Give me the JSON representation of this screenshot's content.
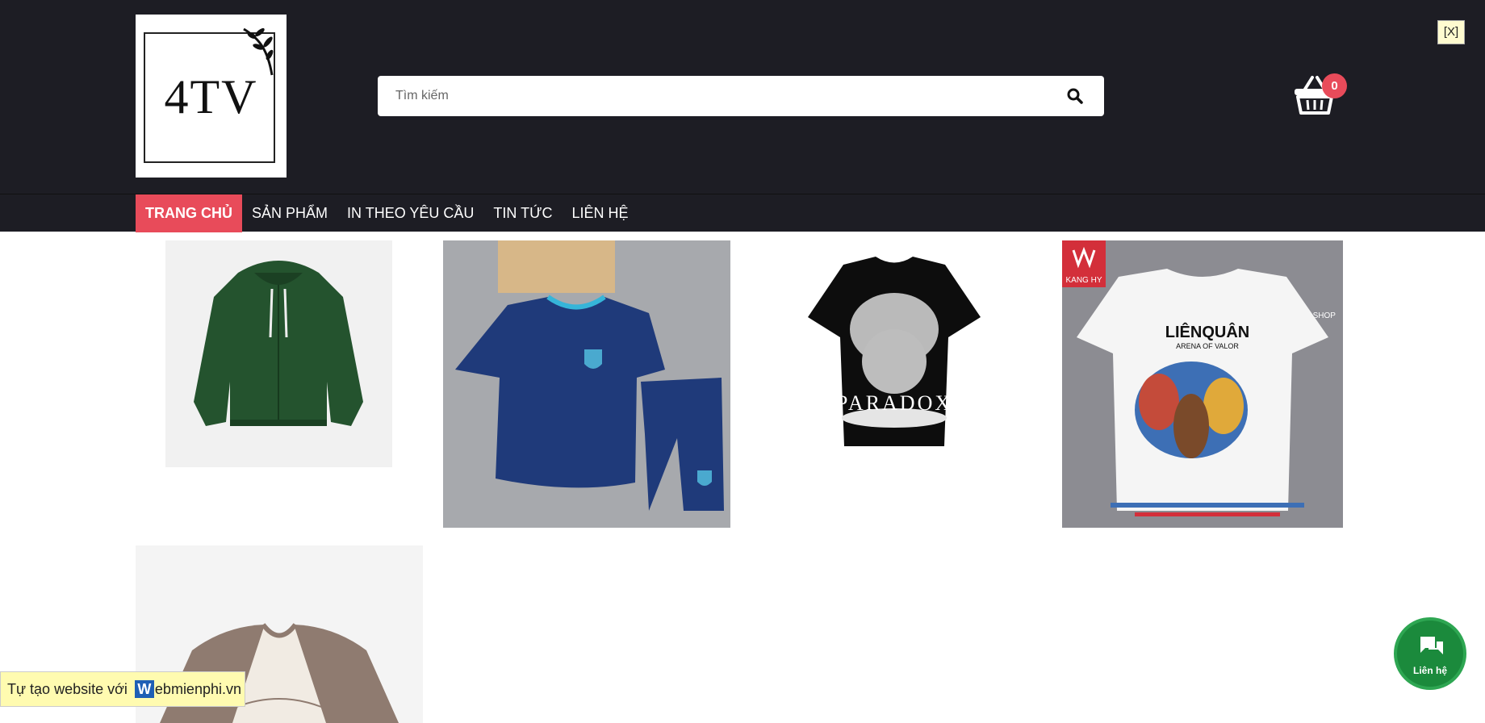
{
  "header": {
    "logo_text": "4TV",
    "search_placeholder": "Tìm kiếm",
    "cart_count": "0",
    "close_label": "[X]"
  },
  "nav": {
    "items": [
      {
        "label": "TRANG CHỦ",
        "active": true
      },
      {
        "label": "SẢN PHẨM"
      },
      {
        "label": "IN THEO YÊU CẦU"
      },
      {
        "label": "TIN TỨC"
      },
      {
        "label": "LIÊN HỆ"
      }
    ]
  },
  "products": [
    {
      "image": "green-hooded-jacket"
    },
    {
      "image": "navy-football-kit"
    },
    {
      "image": "black-paradox-tshirt",
      "print_text": "PARADOX"
    },
    {
      "image": "lien-quan-white-tshirt",
      "print_text": "LIÊNQUÂN",
      "print_subtext": "ARENA OF VALOR",
      "brand_text": "KANG HY",
      "shop_text": "KANG HY SHOP"
    },
    {
      "image": "raglan-tshirt"
    }
  ],
  "footer_badge": {
    "prefix": "Tự tạo website với",
    "w_letter": "W",
    "suffix": "ebmienphi.vn"
  },
  "contact_button": {
    "label": "Liên hệ"
  },
  "colors": {
    "header_bg": "#1d1d24",
    "accent": "#e84b5a",
    "contact_green": "#1b8a3c"
  }
}
